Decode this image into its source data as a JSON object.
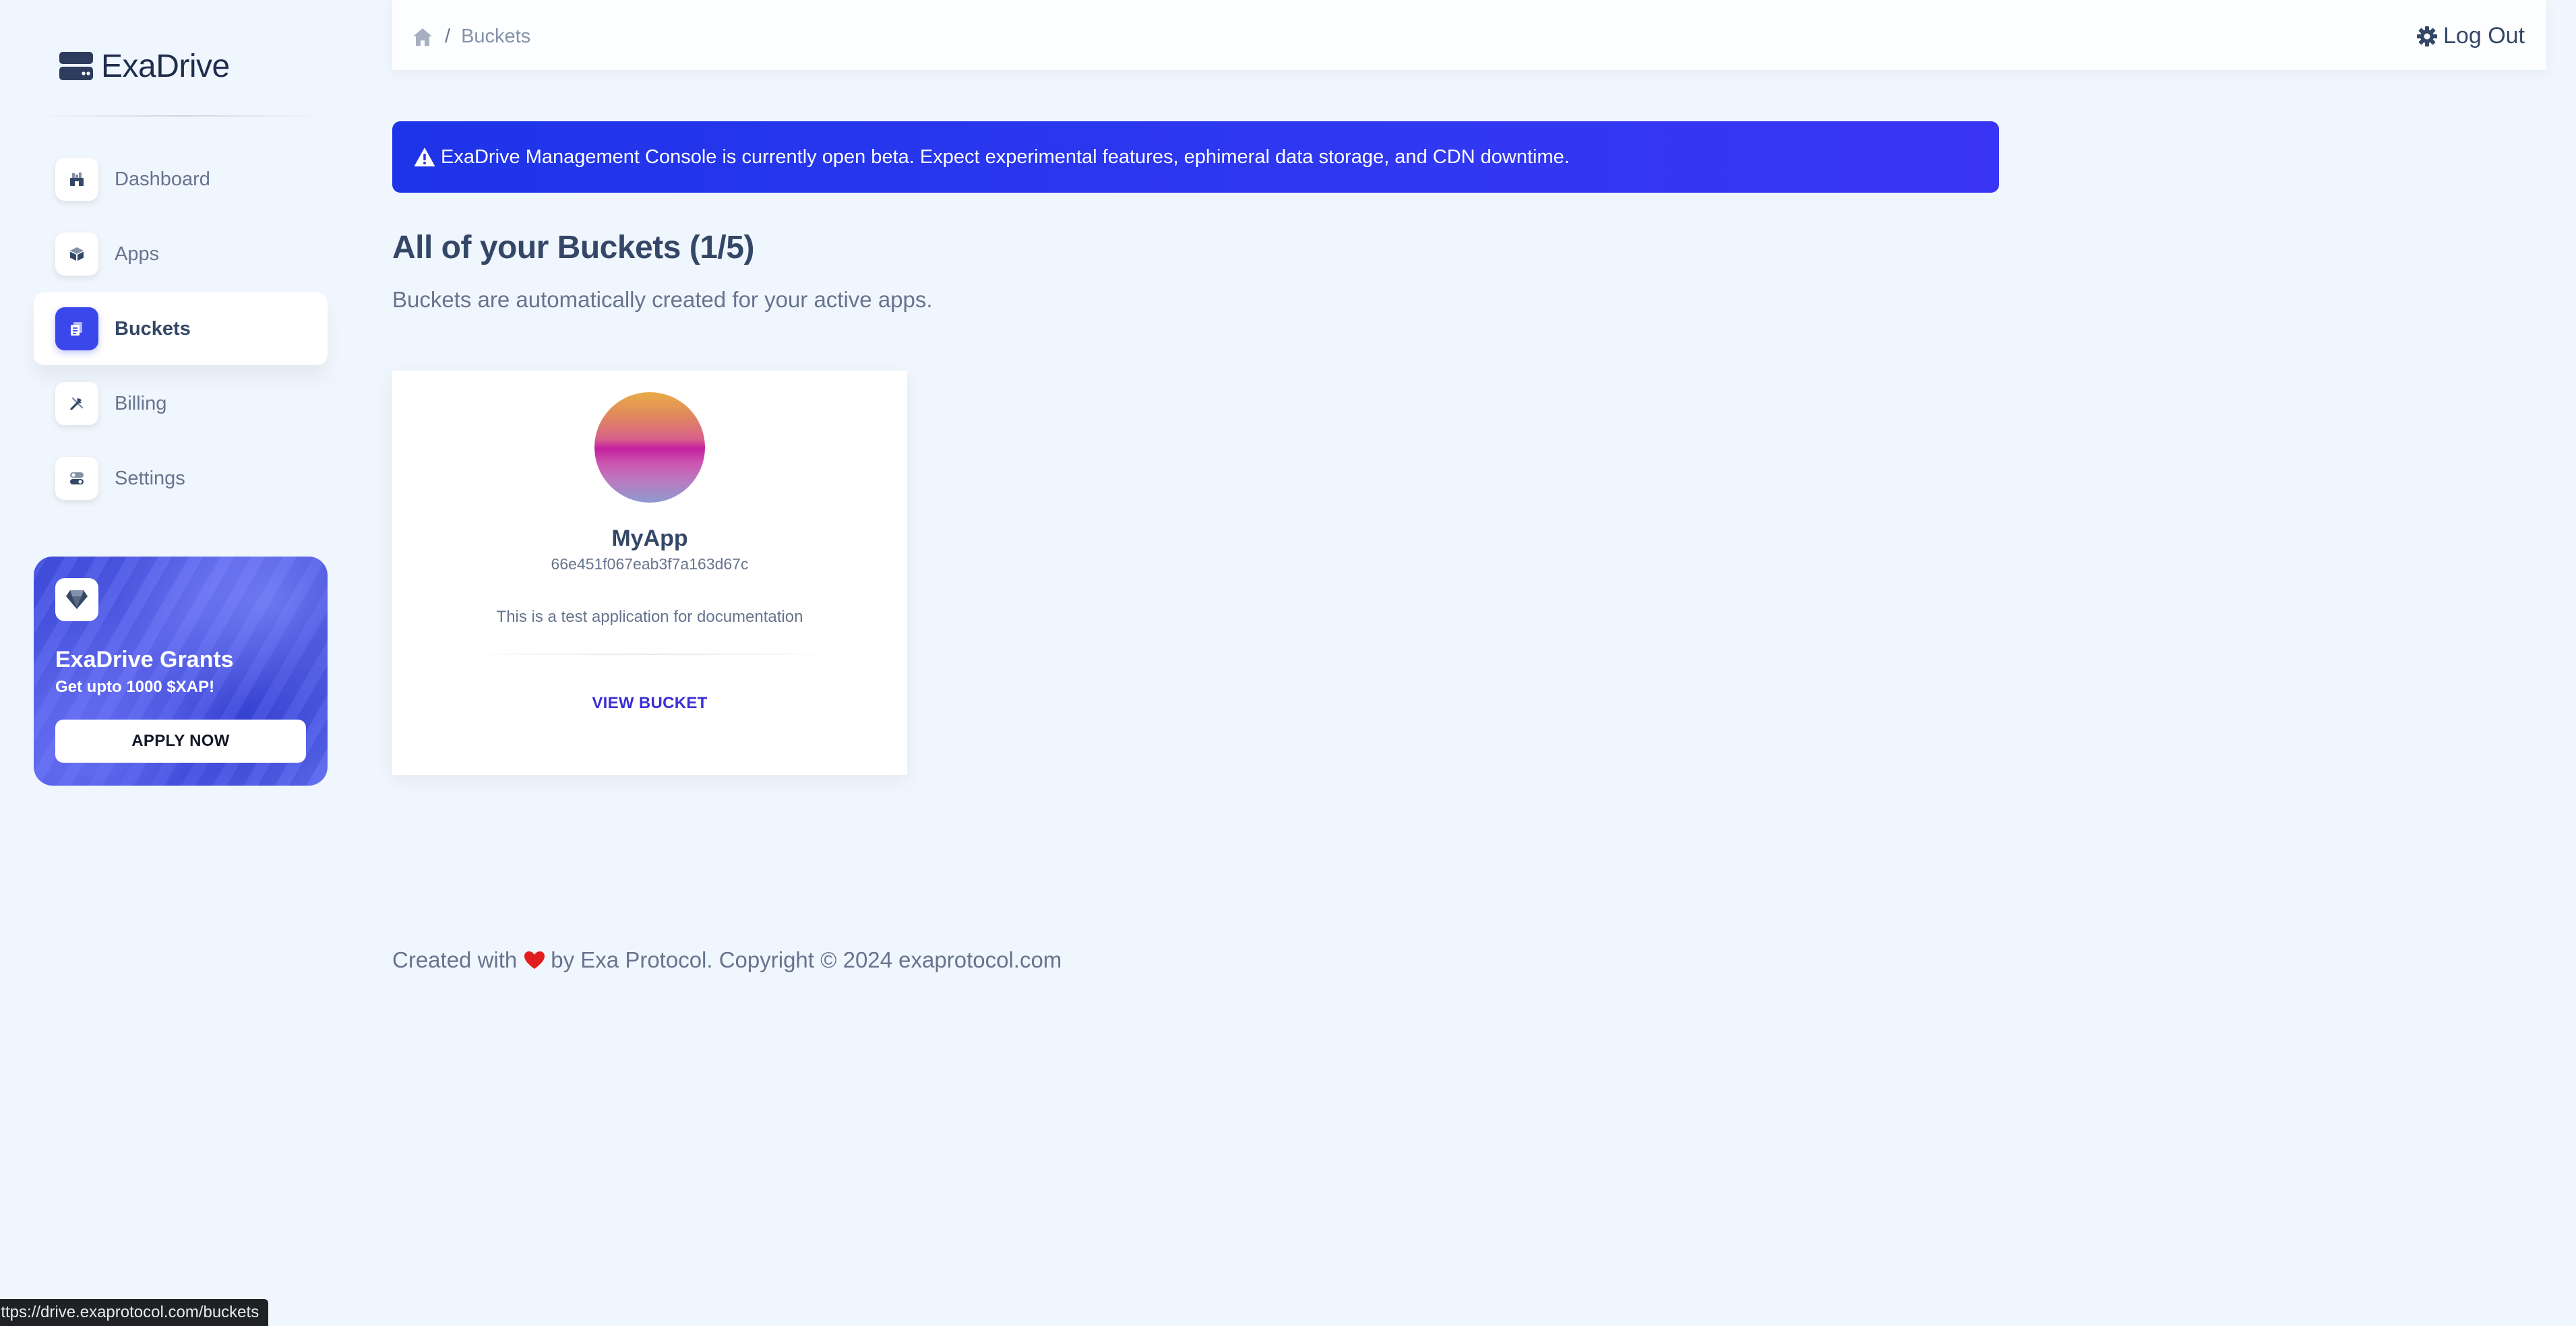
{
  "brand": {
    "name": "ExaDrive"
  },
  "sidebar": {
    "items": [
      {
        "label": "Dashboard",
        "icon": "shop-icon",
        "active": false
      },
      {
        "label": "Apps",
        "icon": "cube-icon",
        "active": false
      },
      {
        "label": "Buckets",
        "icon": "document-icon",
        "active": true
      },
      {
        "label": "Billing",
        "icon": "tools-icon",
        "active": false
      },
      {
        "label": "Settings",
        "icon": "switches-icon",
        "active": false
      }
    ],
    "grants": {
      "icon": "diamond-icon",
      "title": "ExaDrive Grants",
      "subtitle": "Get upto 1000 $XAP!",
      "button": "APPLY NOW"
    }
  },
  "topbar": {
    "breadcrumb": {
      "home_icon": "home-icon",
      "separator": "/",
      "current": "Buckets"
    },
    "logout_label": "Log Out",
    "logout_icon": "gear-icon"
  },
  "alert": {
    "icon": "warning-icon",
    "text": "ExaDrive Management Console is currently open beta. Expect experimental features, ephimeral data storage, and CDN downtime."
  },
  "main": {
    "title": "All of your Buckets (1/5)",
    "subtitle": "Buckets are automatically created for your active apps."
  },
  "buckets": [
    {
      "name": "MyApp",
      "id": "66e451f067eab3f7a163d67c",
      "description": "This is a test application for documentation",
      "action": "VIEW BUCKET"
    }
  ],
  "footer": {
    "prefix": "Created with",
    "suffix": "by Exa Protocol. Copyright © 2024 exaprotocol.com",
    "heart_color": "#e11d1d"
  },
  "status_bar": {
    "url": "https://drive.exaprotocol.com/buckets"
  },
  "colors": {
    "accent": "#3a47ea",
    "alert_bg": "#2f38f1",
    "text_primary": "#344767",
    "text_secondary": "#67748e",
    "page_bg": "#f0f6fd"
  }
}
